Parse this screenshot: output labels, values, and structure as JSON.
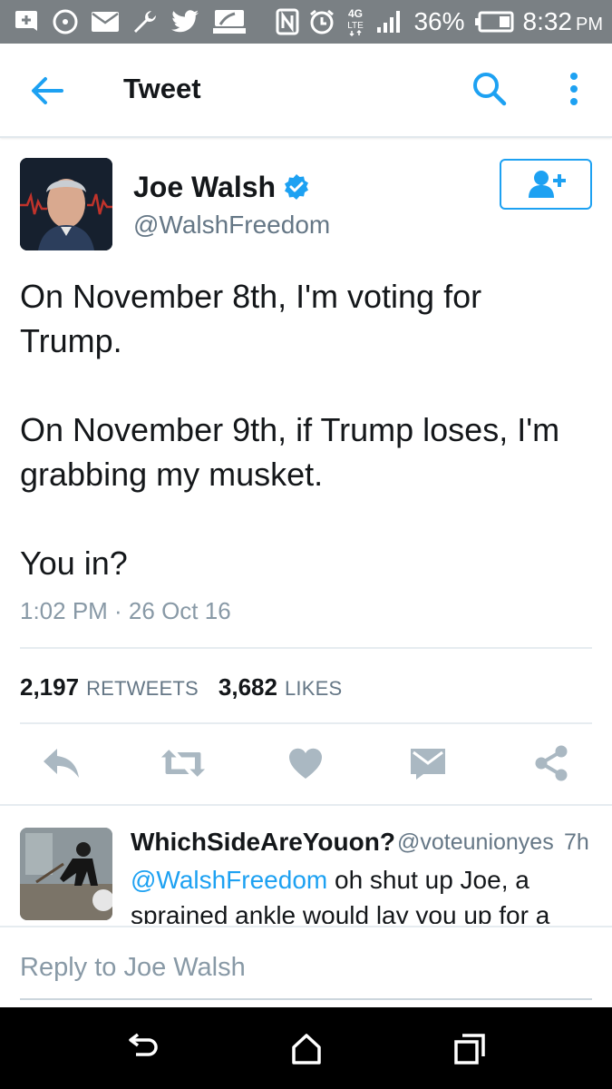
{
  "status_bar": {
    "battery_percent": "36%",
    "time": "8:32",
    "ampm": "PM",
    "network": "4G LTE"
  },
  "app_bar": {
    "title": "Tweet"
  },
  "tweet": {
    "author_name": "Joe Walsh",
    "author_handle": "@WalshFreedom",
    "verified": true,
    "text": "On November 8th, I'm voting for Trump.\n\nOn November 9th, if Trump loses, I'm grabbing my musket.\n\nYou in?",
    "timestamp": "1:02 PM · 26 Oct 16",
    "retweets_count": "2,197",
    "retweets_label": "RETWEETS",
    "likes_count": "3,682",
    "likes_label": "LIKES"
  },
  "reply": {
    "name": "WhichSideAreYouon?",
    "handle": "@voteunionyes",
    "time": "7h",
    "mention": "@WalshFreedom",
    "text": " oh shut up Joe, a sprained ankle would lay you up for a"
  },
  "reply_box": {
    "placeholder": "Reply to Joe Walsh"
  },
  "colors": {
    "accent": "#1da1f2",
    "status_bar": "#7a8084",
    "action_icons": "#aab8c2"
  },
  "icons": {
    "back": "arrow-left-icon",
    "search": "search-icon",
    "more": "more-vertical-icon",
    "follow": "follow-user-icon",
    "reply": "reply-icon",
    "retweet": "retweet-icon",
    "like": "heart-icon",
    "dm": "envelope-icon",
    "share": "share-icon"
  }
}
